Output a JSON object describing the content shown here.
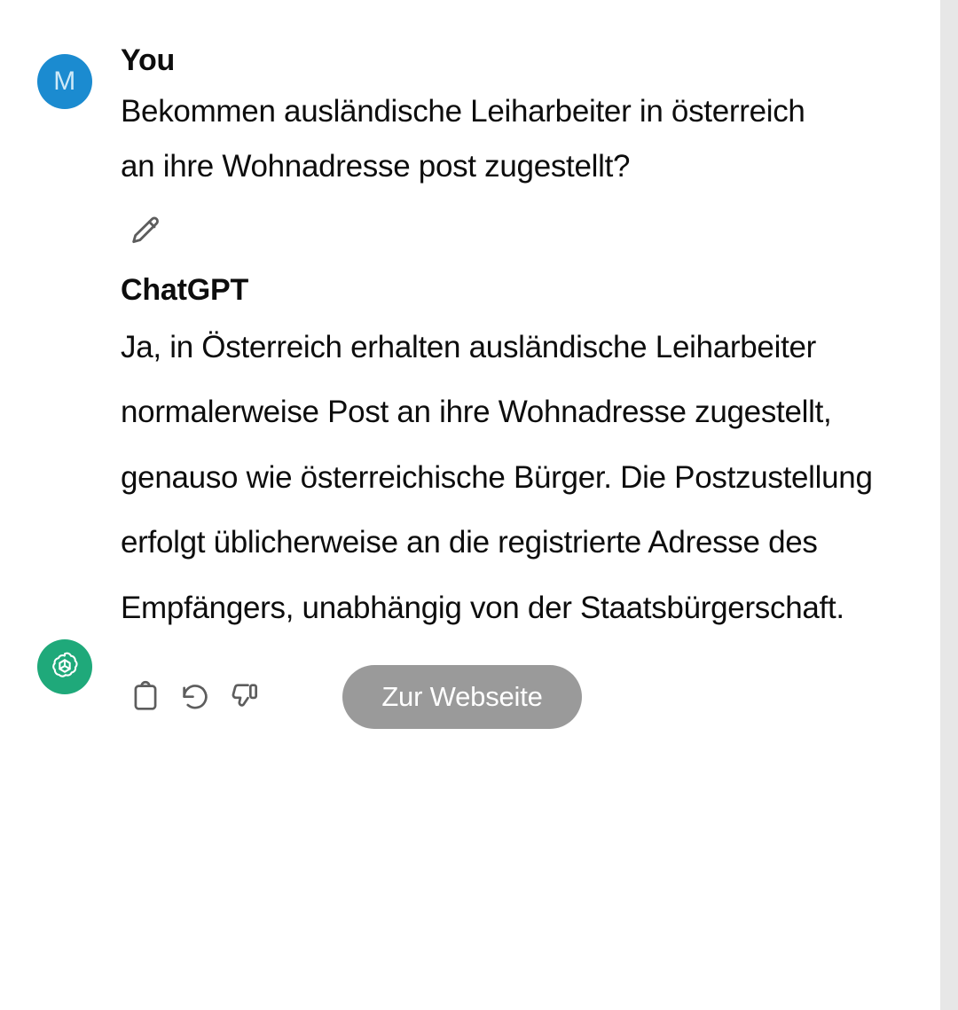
{
  "theme": {
    "background": "#ffffff",
    "text_color": "#0d0d0d",
    "gutter_color": "#e7e7e7",
    "user_avatar_color": "#1b8bd0",
    "assistant_avatar_color": "#1fa97a",
    "cta_background": "#9a9a9a",
    "cta_text_color": "#ffffff",
    "icon_color": "#5d5d5d"
  },
  "conversation": {
    "messages": [
      {
        "role": "user",
        "author": "You",
        "avatar_initial": "M",
        "avatar_icon": "user-initial-avatar",
        "text": "Bekommen ausländische Leiharbeiter in österreich an ihre Wohnadresse post zugestellt?",
        "actions": [
          {
            "name": "edit-message-button",
            "icon": "pencil-icon",
            "label": ""
          }
        ]
      },
      {
        "role": "assistant",
        "author": "ChatGPT",
        "avatar_icon": "openai-logo-icon",
        "text": "Ja, in Österreich erhalten ausländische Leiharbeiter normalerweise Post an ihre Wohnadresse zugestellt, genauso wie österreichische Bürger. Die Postzustellung erfolgt üblicherweise an die registrierte Adresse des Empfängers, unabhängig von der Staatsbürgerschaft.",
        "actions": [
          {
            "name": "copy-button",
            "icon": "clipboard-icon",
            "label": ""
          },
          {
            "name": "regenerate-button",
            "icon": "rotate-ccw-icon",
            "label": ""
          },
          {
            "name": "thumbs-down-button",
            "icon": "thumbs-down-icon",
            "label": ""
          }
        ],
        "cta": {
          "name": "open-website-button",
          "label": "Zur Webseite"
        }
      }
    ]
  }
}
